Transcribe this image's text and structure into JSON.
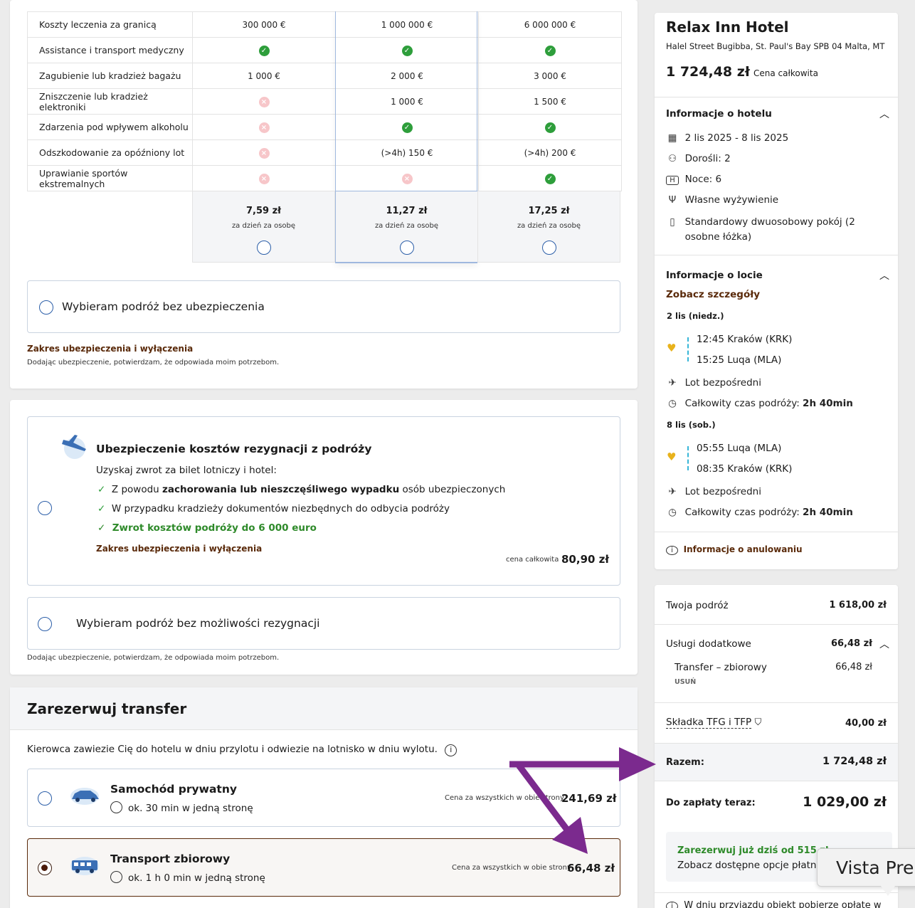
{
  "coverage": {
    "rows": [
      {
        "label": "Koszty leczenia za granicą",
        "cells": [
          "300 000 €",
          "1 000 000 €",
          "6 000 000 €"
        ]
      },
      {
        "label": "Assistance i transport medyczny",
        "cells": [
          "check",
          "check",
          "check"
        ]
      },
      {
        "label": "Zagubienie lub kradzież bagażu",
        "cells": [
          "1 000 €",
          "2 000 €",
          "3 000 €"
        ]
      },
      {
        "label": "Zniszczenie lub kradzież elektroniki",
        "cells": [
          "cross",
          "1 000 €",
          "1 500 €"
        ]
      },
      {
        "label": "Zdarzenia pod wpływem alkoholu",
        "cells": [
          "cross",
          "check",
          "check"
        ]
      },
      {
        "label": "Odszkodowanie za opóźniony lot",
        "cells": [
          "cross",
          "(>4h) 150 €",
          "(>4h) 200 €"
        ]
      },
      {
        "label": "Uprawianie sportów ekstremalnych",
        "cells": [
          "cross",
          "cross",
          "check"
        ]
      }
    ],
    "prices": [
      {
        "price": "7,59 zł",
        "sub": "za dzień za osobę"
      },
      {
        "price": "11,27 zł",
        "sub": "za dzień za osobę"
      },
      {
        "price": "17,25 zł",
        "sub": "za dzień za osobę"
      }
    ],
    "no_insurance": "Wybieram podróż bez ubezpieczenia",
    "scope_link": "Zakres ubezpieczenia i wyłączenia",
    "confirm": "Dodając ubezpieczenie, potwierdzam, że odpowiada moim potrzebom."
  },
  "cancellation": {
    "title": "Ubezpieczenie kosztów rezygnacji z podróży",
    "intro": "Uzyskaj zwrot za bilet lotniczy i hotel:",
    "b1_pre": "Z powodu ",
    "b1_bold": "zachorowania lub nieszczęśliwego wypadku",
    "b1_post": " osób ubezpieczonych",
    "b2": "W przypadku kradzieży dokumentów niezbędnych do odbycia podróży",
    "b3": "Zwrot kosztów podróży do 6 000 euro",
    "scope_link": "Zakres ubezpieczenia i wyłączenia",
    "price_label": "cena całkowita",
    "price": "80,90 zł",
    "no_option": "Wybieram podróż bez możliwości rezygnacji",
    "confirm": "Dodając ubezpieczenie, potwierdzam, że odpowiada moim potrzebom."
  },
  "transfer": {
    "heading": "Zarezerwuj transfer",
    "desc": "Kierowca zawiezie Cię do hotelu w dniu przylotu i odwiezie na lotnisko w dniu wylotu.",
    "options": [
      {
        "title": "Samochód prywatny",
        "duration": "ok. 30 min w jedną stronę",
        "price_label": "Cena za wszystkich w obie strony",
        "price": "241,69 zł"
      },
      {
        "title": "Transport zbiorowy",
        "duration": "ok. 1 h 0 min w jedną stronę",
        "price_label": "Cena za wszystkich w obie strony",
        "price": "66,48 zł"
      }
    ]
  },
  "hotel": {
    "name": "Relax Inn Hotel",
    "address": "Halel Street Bugibba, St. Paul's Bay SPB 04 Malta, MT",
    "total": "1 724,48 zł",
    "total_label": "Cena całkowita",
    "info_title": "Informacje o hotelu",
    "dates": "2 lis 2025 - 8 lis 2025",
    "adults": "Dorośli: 2",
    "nights": "Noce: 6",
    "board": "Własne wyżywienie",
    "room_l1": "Standardowy dwuosobowy pokój (2",
    "room_l2": "osobne łóżka)"
  },
  "flight": {
    "title": "Informacje o locie",
    "details_link": "Zobacz szczegóły",
    "out_date": "2 lis (niedz.)",
    "out_dep": "12:45 Kraków (KRK)",
    "out_arr": "15:25 Luqa (MLA)",
    "direct": "Lot bezpośredni",
    "total_time_label": "Całkowity czas podróży: ",
    "total_time": "2h 40min",
    "ret_date": "8 lis (sob.)",
    "ret_dep": "05:55 Luqa (MLA)",
    "ret_arr": "08:35 Kraków (KRK)",
    "cancel_info": "Informacje o anulowaniu"
  },
  "summary": {
    "trip_label": "Twoja podróż",
    "trip_value": "1 618,00 zł",
    "extras_label": "Usługi dodatkowe",
    "extras_value": "66,48 zł",
    "transfer_label": "Transfer – zbiorowy",
    "transfer_value": "66,48 zł",
    "remove": "USUŃ",
    "tfg_label": "Składka TFG i TFP",
    "tfg_value": "40,00 zł",
    "sum_label": "Razem:",
    "sum_value": "1 724,48 zł",
    "pay_label": "Do zapłaty teraz:",
    "pay_value": "1 029,00 zł",
    "promo_title": "Zarezerwuj już dziś od 515 zł",
    "promo_sub": "Zobacz dostępne opcje płatno",
    "footer_cut": "W dniu przyjazdu obiekt pobierze opłatę w",
    "tooltip": "Vista Pre"
  },
  "colors": {
    "accent_brown": "#5a2a0a",
    "arrow_purple": "#7b2a8e",
    "check_green": "#2e9e3b"
  }
}
